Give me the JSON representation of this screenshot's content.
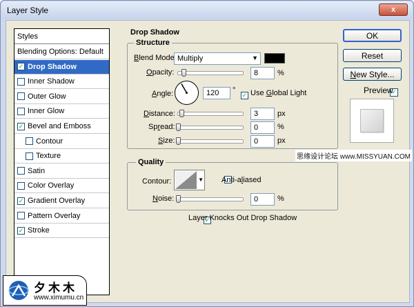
{
  "window": {
    "title": "Layer Style",
    "close_glyph": "x"
  },
  "styles_panel": {
    "header": "Styles",
    "items": [
      {
        "label": "Blending Options: Default",
        "checkbox": false,
        "checked": false,
        "selected": false,
        "sub": false
      },
      {
        "label": "Drop Shadow",
        "checkbox": true,
        "checked": true,
        "selected": true,
        "sub": false
      },
      {
        "label": "Inner Shadow",
        "checkbox": true,
        "checked": false,
        "selected": false,
        "sub": false
      },
      {
        "label": "Outer Glow",
        "checkbox": true,
        "checked": false,
        "selected": false,
        "sub": false
      },
      {
        "label": "Inner Glow",
        "checkbox": true,
        "checked": false,
        "selected": false,
        "sub": false
      },
      {
        "label": "Bevel and Emboss",
        "checkbox": true,
        "checked": true,
        "selected": false,
        "sub": false
      },
      {
        "label": "Contour",
        "checkbox": true,
        "checked": false,
        "selected": false,
        "sub": true
      },
      {
        "label": "Texture",
        "checkbox": true,
        "checked": false,
        "selected": false,
        "sub": true
      },
      {
        "label": "Satin",
        "checkbox": true,
        "checked": false,
        "selected": false,
        "sub": false
      },
      {
        "label": "Color Overlay",
        "checkbox": true,
        "checked": false,
        "selected": false,
        "sub": false
      },
      {
        "label": "Gradient Overlay",
        "checkbox": true,
        "checked": true,
        "selected": false,
        "sub": false
      },
      {
        "label": "Pattern Overlay",
        "checkbox": true,
        "checked": false,
        "selected": false,
        "sub": false
      },
      {
        "label": "Stroke",
        "checkbox": true,
        "checked": true,
        "selected": false,
        "sub": false
      }
    ]
  },
  "drop_shadow": {
    "title": "Drop Shadow",
    "structure": {
      "title": "Structure",
      "blend_mode_label": "Blend Mode:",
      "blend_mode_value": "Multiply",
      "shadow_color": "#000000",
      "opacity_label": "Opacity:",
      "opacity_value": "8",
      "opacity_fraction": 0.08,
      "opacity_unit": "%",
      "angle_label": "Angle:",
      "angle_value": "120",
      "angle_unit": "°",
      "use_global_light_label": "Use Global Light",
      "use_global_light_checked": true,
      "distance_label": "Distance:",
      "distance_value": "3",
      "distance_unit": "px",
      "spread_label": "Spread:",
      "spread_value": "0",
      "spread_unit": "%",
      "size_label": "Size:",
      "size_value": "0",
      "size_unit": "px"
    },
    "quality": {
      "title": "Quality",
      "contour_label": "Contour:",
      "anti_aliased_label": "Anti-aliased",
      "anti_aliased_checked": false,
      "noise_label": "Noise:",
      "noise_value": "0",
      "noise_unit": "%"
    },
    "knockout_label": "Layer Knocks Out Drop Shadow",
    "knockout_checked": true
  },
  "buttons": {
    "ok": "OK",
    "reset": "Reset",
    "new_style": "New Style...",
    "preview_label": "Preview",
    "preview_checked": true
  },
  "watermark": "思缘设计论坛 www.MISSYUAN.COM",
  "logo": {
    "chars": "夕木木",
    "url": "www.ximumu.cn"
  },
  "colors": {
    "selection": "#316ac5",
    "check": "#21a121",
    "dialog": "#ece9d8"
  }
}
